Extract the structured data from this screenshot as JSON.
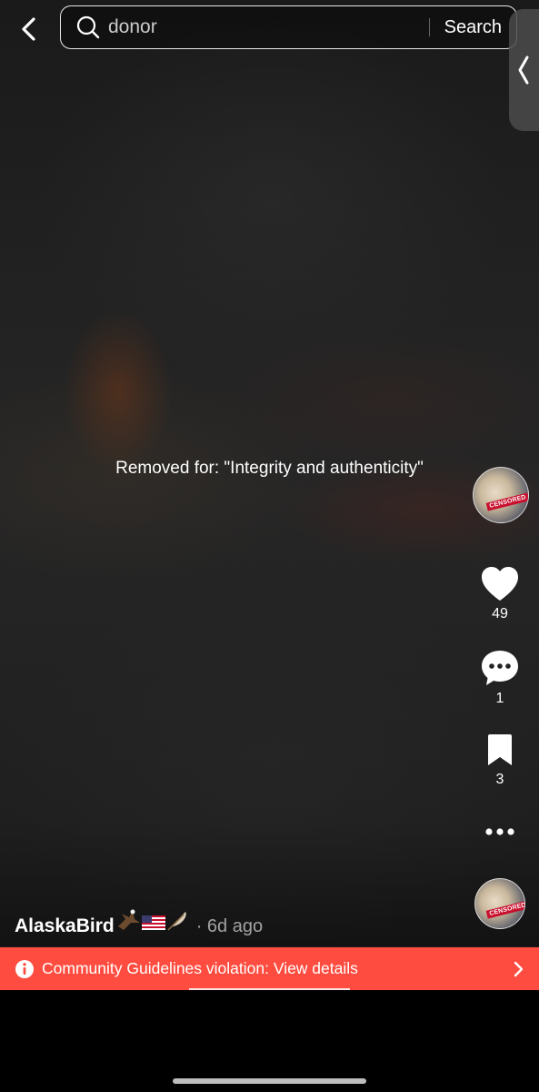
{
  "search": {
    "query": "donor",
    "button_label": "Search"
  },
  "video": {
    "removed_notice": "Removed for: \"Integrity and authenticity\"",
    "author_name": "AlaskaBird",
    "author_emoji": "🦅🇺🇸🪶",
    "post_age": "· 6d ago",
    "avatar_badge": "CENSORED"
  },
  "actions": {
    "likes": "49",
    "comments": "1",
    "saves": "3"
  },
  "violation": {
    "label": "Community Guidelines violation: View details",
    "color": "#fe4d40"
  },
  "icons": {
    "back": "chevron-left-icon",
    "search": "magnifier-icon",
    "side_panel": "chevron-left-icon",
    "like": "heart-icon",
    "comment": "speech-bubble-icon",
    "save": "bookmark-icon",
    "more": "ellipsis-icon",
    "info": "info-circle-icon",
    "violation_more": "chevron-right-icon"
  }
}
